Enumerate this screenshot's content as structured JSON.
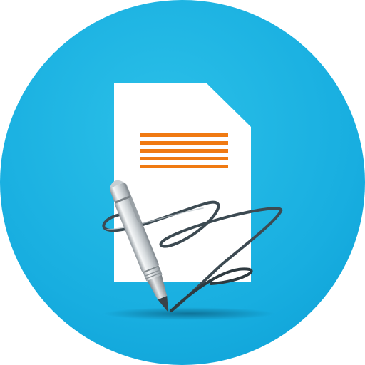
{
  "icon": {
    "name": "document-signing-app-icon",
    "title": "",
    "glyphs": [
      "document-icon",
      "text-lines-icon",
      "signature-scribble-icon",
      "pen-icon"
    ],
    "colors": {
      "circle_light": "#2BC0E8",
      "circle_dark": "#0FA3D8",
      "circle_edge": "#0E96CC",
      "document": "#FFFFFF",
      "text_lines": "#F07A12",
      "signature": "#3C4A52",
      "pen_body": "#D9DDE0",
      "pen_shadow": "#0B6F95"
    },
    "text_line_count": 5
  }
}
